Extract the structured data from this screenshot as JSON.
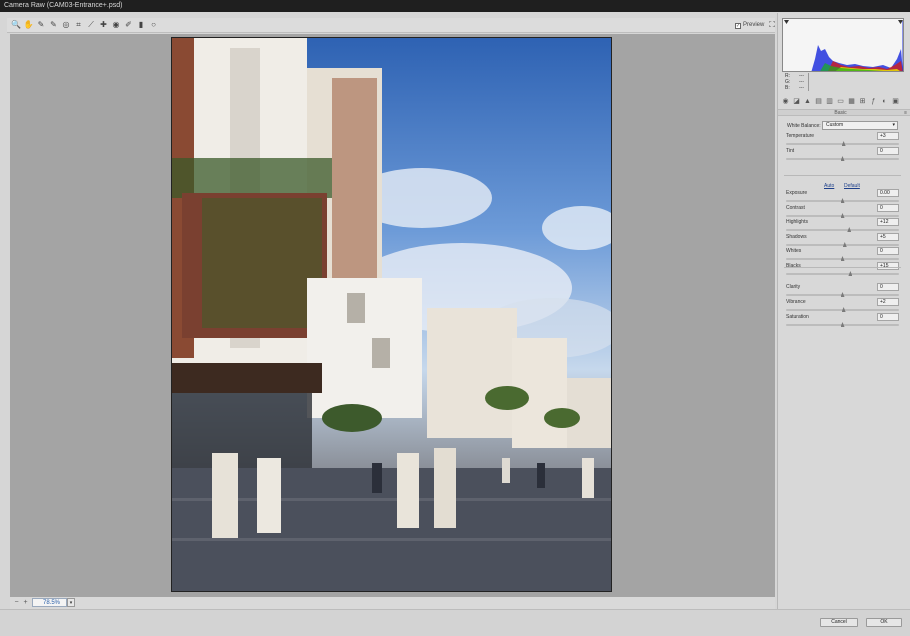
{
  "window": {
    "title": "Camera Raw (CAM03-Entrance+.psd)"
  },
  "toolbar": {
    "tools": [
      {
        "name": "zoom-tool-icon",
        "glyph": "🔍"
      },
      {
        "name": "hand-tool-icon",
        "glyph": "✋"
      },
      {
        "name": "white-balance-tool-icon",
        "glyph": "✎"
      },
      {
        "name": "color-sampler-tool-icon",
        "glyph": "✎"
      },
      {
        "name": "targeted-adjustment-tool-icon",
        "glyph": "◎"
      },
      {
        "name": "crop-tool-icon",
        "glyph": "⌗"
      },
      {
        "name": "straighten-tool-icon",
        "glyph": "⟋"
      },
      {
        "name": "spot-removal-tool-icon",
        "glyph": "✚"
      },
      {
        "name": "red-eye-tool-icon",
        "glyph": "◉"
      },
      {
        "name": "adjustment-brush-icon",
        "glyph": "✐"
      },
      {
        "name": "graduated-filter-icon",
        "glyph": "▮"
      },
      {
        "name": "radial-filter-icon",
        "glyph": "○"
      }
    ],
    "preview_label": "Preview"
  },
  "zoom": {
    "value": "78.5%"
  },
  "histogram": {
    "r_label": "R:",
    "g_label": "G:",
    "b_label": "B:",
    "r_value": "---",
    "g_value": "---",
    "b_value": "---"
  },
  "panel": {
    "section_title": "Basic",
    "white_balance_label": "White Balance:",
    "white_balance_value": "Custom",
    "auto_label": "Auto",
    "default_label": "Default",
    "sliders": [
      {
        "label": "Temperature",
        "value": "+3",
        "fraction": 0.51
      },
      {
        "label": "Tint",
        "value": "0",
        "fraction": 0.5
      },
      {
        "label": "Exposure",
        "value": "0.00",
        "fraction": 0.5
      },
      {
        "label": "Contrast",
        "value": "0",
        "fraction": 0.5
      },
      {
        "label": "Highlights",
        "value": "+12",
        "fraction": 0.56
      },
      {
        "label": "Shadows",
        "value": "+5",
        "fraction": 0.52
      },
      {
        "label": "Whites",
        "value": "0",
        "fraction": 0.5
      },
      {
        "label": "Blacks",
        "value": "+15",
        "fraction": 0.57
      },
      {
        "label": "Clarity",
        "value": "0",
        "fraction": 0.5
      },
      {
        "label": "Vibrance",
        "value": "+2",
        "fraction": 0.51
      },
      {
        "label": "Saturation",
        "value": "0",
        "fraction": 0.5
      }
    ]
  },
  "buttons": {
    "cancel": "Cancel",
    "ok": "OK"
  },
  "colors": {
    "accent": "#2a5fa8",
    "canvas": "#a4a4a4",
    "panel": "#d8d8d8"
  }
}
